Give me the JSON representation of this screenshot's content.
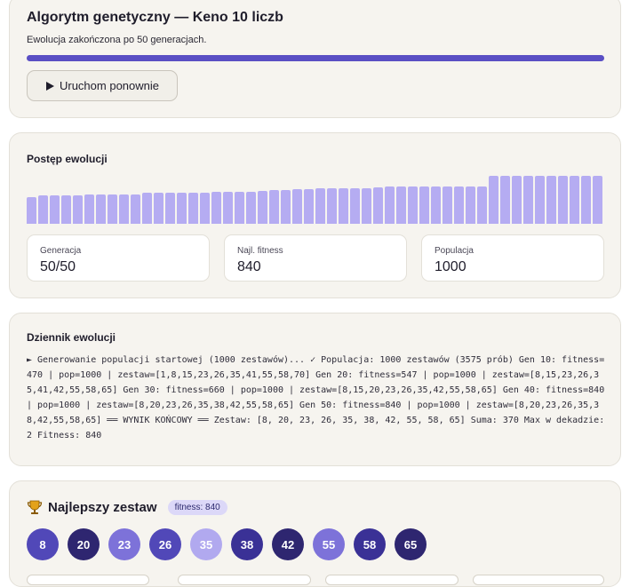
{
  "header": {
    "title": "Algorytm genetyczny — Keno 10 liczb",
    "status": "Ewolucja zakończona po 50 generacjach.",
    "progress": 1.0,
    "rerun_label": "Uruchom ponownie",
    "rerun_icon": "play-icon"
  },
  "evolution": {
    "label": "Postęp ewolucji",
    "bar_values": [
      470,
      500,
      500,
      500,
      500,
      510,
      520,
      520,
      520,
      520,
      540,
      547,
      547,
      547,
      547,
      550,
      555,
      555,
      560,
      560,
      580,
      590,
      590,
      600,
      610,
      620,
      620,
      620,
      620,
      620,
      640,
      650,
      650,
      650,
      650,
      655,
      660,
      660,
      660,
      660,
      840,
      840,
      840,
      840,
      840,
      840,
      840,
      840,
      840,
      840
    ],
    "bar_max": 840,
    "stats": [
      {
        "label": "Generacja",
        "value": "50/50"
      },
      {
        "label": "Najl. fitness",
        "value": "840"
      },
      {
        "label": "Populacja",
        "value": "1000"
      }
    ]
  },
  "log": {
    "label": "Dziennik ewolucji",
    "text": "► Generowanie populacji startowej (1000 zestawów)... ✓ Populacja: 1000 zestawów (3575 prób) Gen 10: fitness=470 | pop=1000 | zestaw=[1,8,15,23,26,35,41,55,58,70] Gen 20: fitness=547 | pop=1000 | zestaw=[8,15,23,26,35,41,42,55,58,65] Gen 30: fitness=660 | pop=1000 | zestaw=[8,15,20,23,26,35,42,55,58,65] Gen 40: fitness=840 | pop=1000 | zestaw=[8,20,23,26,35,38,42,55,58,65] Gen 50: fitness=840 | pop=1000 | zestaw=[8,20,23,26,35,38,42,55,58,65] ══ WYNIK KOŃCOWY ══ Zestaw: [8, 20, 23, 26, 35, 38, 42, 55, 58, 65] Suma: 370 Max w dekadzie: 2 Fitness: 840"
  },
  "best": {
    "icon": "trophy-icon",
    "title": "Najlepszy zestaw",
    "badge": "fitness: 840",
    "numbers": [
      {
        "n": "8",
        "color": "#5148b8"
      },
      {
        "n": "20",
        "color": "#2e2670"
      },
      {
        "n": "23",
        "color": "#7d72d9"
      },
      {
        "n": "26",
        "color": "#5148b8"
      },
      {
        "n": "35",
        "color": "#b1a9ef"
      },
      {
        "n": "38",
        "color": "#3a3196"
      },
      {
        "n": "42",
        "color": "#2e2670"
      },
      {
        "n": "55",
        "color": "#7d72d9"
      },
      {
        "n": "58",
        "color": "#3a3196"
      },
      {
        "n": "65",
        "color": "#2e2670"
      }
    ]
  },
  "colors": {
    "accent": "#5a4fc4",
    "bar": "#b5acf2"
  }
}
